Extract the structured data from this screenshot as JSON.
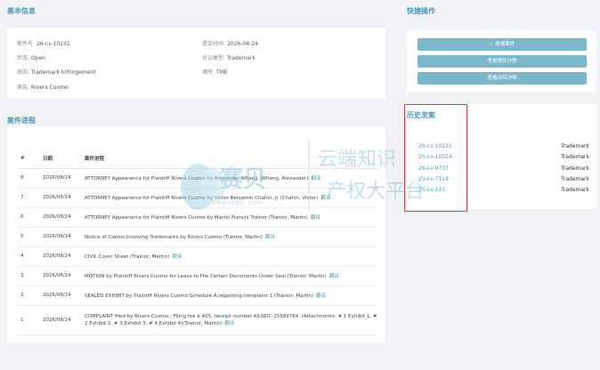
{
  "basic_info": {
    "title": "基本信息",
    "case_no_label": "案件号:",
    "case_no": "26-cv-10231",
    "submit_date_label": "提交时间:",
    "submit_date": "2026-08-24",
    "status_label": "状态:",
    "status": "Open",
    "case_type_label": "诉讼类型:",
    "case_type": "Trademark",
    "cause_label": "原因:",
    "cause": "Trademark Infringement",
    "lawyer_label": "律所:",
    "lawyer": "TME",
    "plaintiff_label": "原告:",
    "plaintiff": "Rivers Cuomo"
  },
  "quick_actions": {
    "title": "快捷操作",
    "favorite": "☆ 收藏案件",
    "view_detail": "查看律所详情",
    "view_court": "查看法院详情"
  },
  "progress": {
    "title": "案件进程",
    "col_idx": "#",
    "col_date": "日期",
    "col_event": "案件进程",
    "translate_label": "翻译",
    "rows": [
      {
        "idx": "8",
        "date": "2026/08/24",
        "event": "ATTORNEY Appearance for Plaintiff Rivers Cuomo by Alexander Whang (Whang, Alexander)"
      },
      {
        "idx": "7",
        "date": "2026/08/24",
        "event": "ATTORNEY Appearance for Plaintiff Rivers Cuomo by Victor Benjamin Chahin, Jr (Chahin, Victor)"
      },
      {
        "idx": "6",
        "date": "2026/08/24",
        "event": "ATTORNEY Appearance for Plaintiff Rivers Cuomo by Martin Francis Trainor (Trainor, Martin)"
      },
      {
        "idx": "5",
        "date": "2026/08/24",
        "event": "Notice of Claims Involving Trademarks by Rivers Cuomo (Trainor, Martin)"
      },
      {
        "idx": "4",
        "date": "2026/08/24",
        "event": "CIVIL Cover Sheet (Trainor, Martin)"
      },
      {
        "idx": "3",
        "date": "2026/08/24",
        "event": "MOTION by Plaintiff Rivers Cuomo for Leave to File Certain Documents Under Seal (Trainor, Martin)"
      },
      {
        "idx": "2",
        "date": "2026/08/24",
        "event": "SEALED EXHIBIT by Plaintiff Rivers Cuomo Schedule A regarding complaint 1 (Trainor, Martin)"
      },
      {
        "idx": "1",
        "date": "2026/08/24",
        "event": "COMPLAINT filed by Rivers Cuomo ; Filing fee $ 405, receipt number AILNDC-25569764. (Attachments: # 1 Exhibit 1, # 2 Exhibit 2, # 3 Exhibit 3, # 4 Exhibit 4)(Trainor, Martin)"
      }
    ]
  },
  "history": {
    "title": "历史发案",
    "rows": [
      {
        "num": "26-cv-10231",
        "type": "Trademark"
      },
      {
        "num": "25-cv-10024",
        "type": "Trademark"
      },
      {
        "num": "26-cv-9737",
        "type": "Trademark"
      },
      {
        "num": "25-cv-7119",
        "type": "Trademark"
      },
      {
        "num": "25-cv-115",
        "type": "Trademark"
      }
    ]
  },
  "watermark": {
    "brand_cn": "赛贝",
    "brand_url": "www.saibei.com",
    "slogan_1": "云端知识",
    "slogan_2": "产权大平台"
  },
  "colors": {
    "accent": "#4a9ab3",
    "button": "#7bb8cb",
    "highlight": "#e23c3c"
  }
}
